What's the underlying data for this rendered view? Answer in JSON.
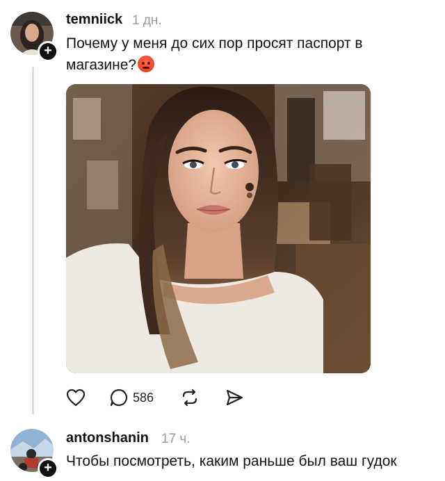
{
  "post": {
    "username": "temniick",
    "time": "1 дн.",
    "text": "Почему у меня до сих пор просят паспорт в магазине?",
    "emoji": "angry-face-emoji",
    "reply_count": "586"
  },
  "reply": {
    "username": "antonshanin",
    "time": "17 ч.",
    "text": "Чтобы посмотреть, каким раньше был ваш гудок"
  },
  "icons": {
    "like": "heart-icon",
    "comment": "comment-bubble-icon",
    "repost": "repost-icon",
    "share": "send-icon",
    "follow": "plus-icon"
  },
  "colors": {
    "text": "#111111",
    "muted": "#9b9b9b",
    "thread_line": "#dcdcdc"
  }
}
